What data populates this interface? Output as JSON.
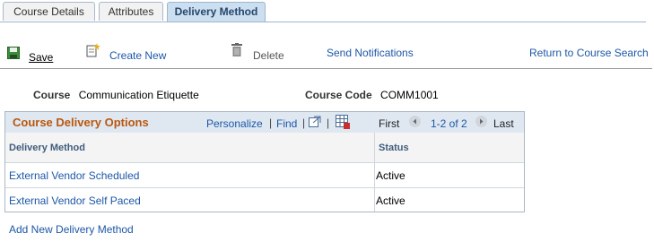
{
  "tabs": [
    {
      "label": "Course Details",
      "active": false
    },
    {
      "label": "Attributes",
      "active": false
    },
    {
      "label": "Delivery Method",
      "active": true
    }
  ],
  "toolbar": {
    "save_label": "Save",
    "create_new_label": "Create New",
    "delete_label": "Delete",
    "send_notifications_label": "Send Notifications",
    "return_label": "Return to Course Search"
  },
  "course": {
    "course_label": "Course",
    "course_value": "Communication Etiquette",
    "code_label": "Course Code",
    "code_value": "COMM1001"
  },
  "grid": {
    "title": "Course Delivery Options",
    "personalize": "Personalize",
    "separator": "|",
    "find": "Find",
    "first": "First",
    "range": "1-2 of 2",
    "last": "Last",
    "columns": [
      "Delivery Method",
      "Status"
    ],
    "rows": [
      {
        "method": "External Vendor Scheduled",
        "status": "Active"
      },
      {
        "method": "External Vendor Self Paced",
        "status": "Active"
      }
    ]
  },
  "add_link": "Add New Delivery Method",
  "colors": {
    "link": "#1d57a8",
    "grid_title": "#b9570e",
    "active_tab": "#ccdff0"
  }
}
